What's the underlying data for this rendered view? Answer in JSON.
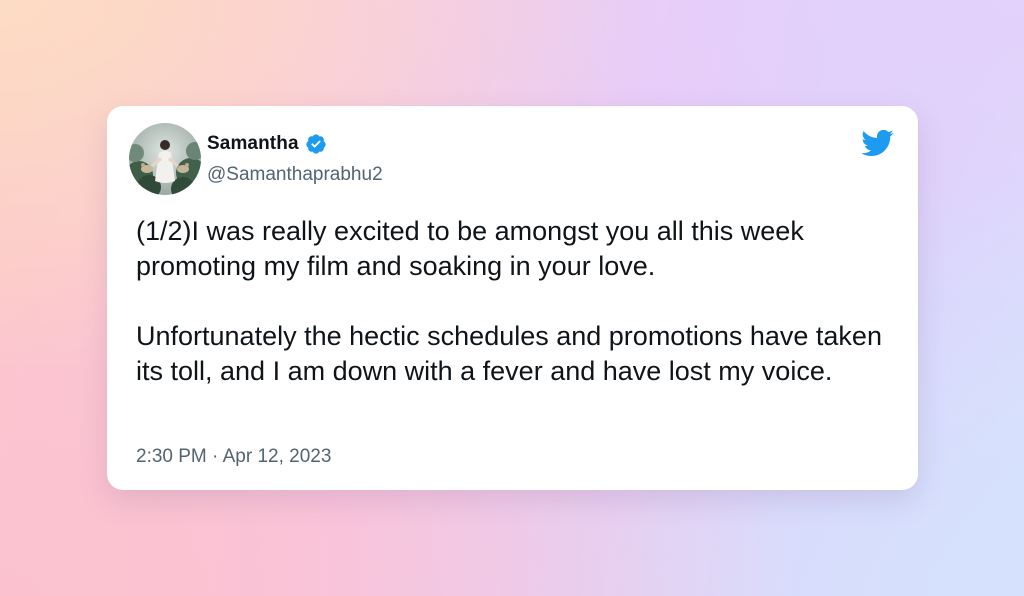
{
  "tweet": {
    "author": {
      "name": "Samantha",
      "handle": "@Samanthaprabhu2",
      "verified": true,
      "avatar": "profile-photo-avatar"
    },
    "paragraphs": [
      "(1/2)I was really excited to be amongst you all this week promoting my film and soaking in your love.",
      "Unfortunately the hectic schedules and promotions have taken its toll, and I am down with a fever and have lost my voice."
    ],
    "timestamp": "2:30 PM · Apr 12, 2023",
    "brand_icon": "twitter-bird-icon"
  },
  "colors": {
    "text_primary": "#0f1419",
    "text_secondary": "#536471",
    "twitter_blue": "#1d9bf0",
    "card_background": "#ffffff"
  }
}
